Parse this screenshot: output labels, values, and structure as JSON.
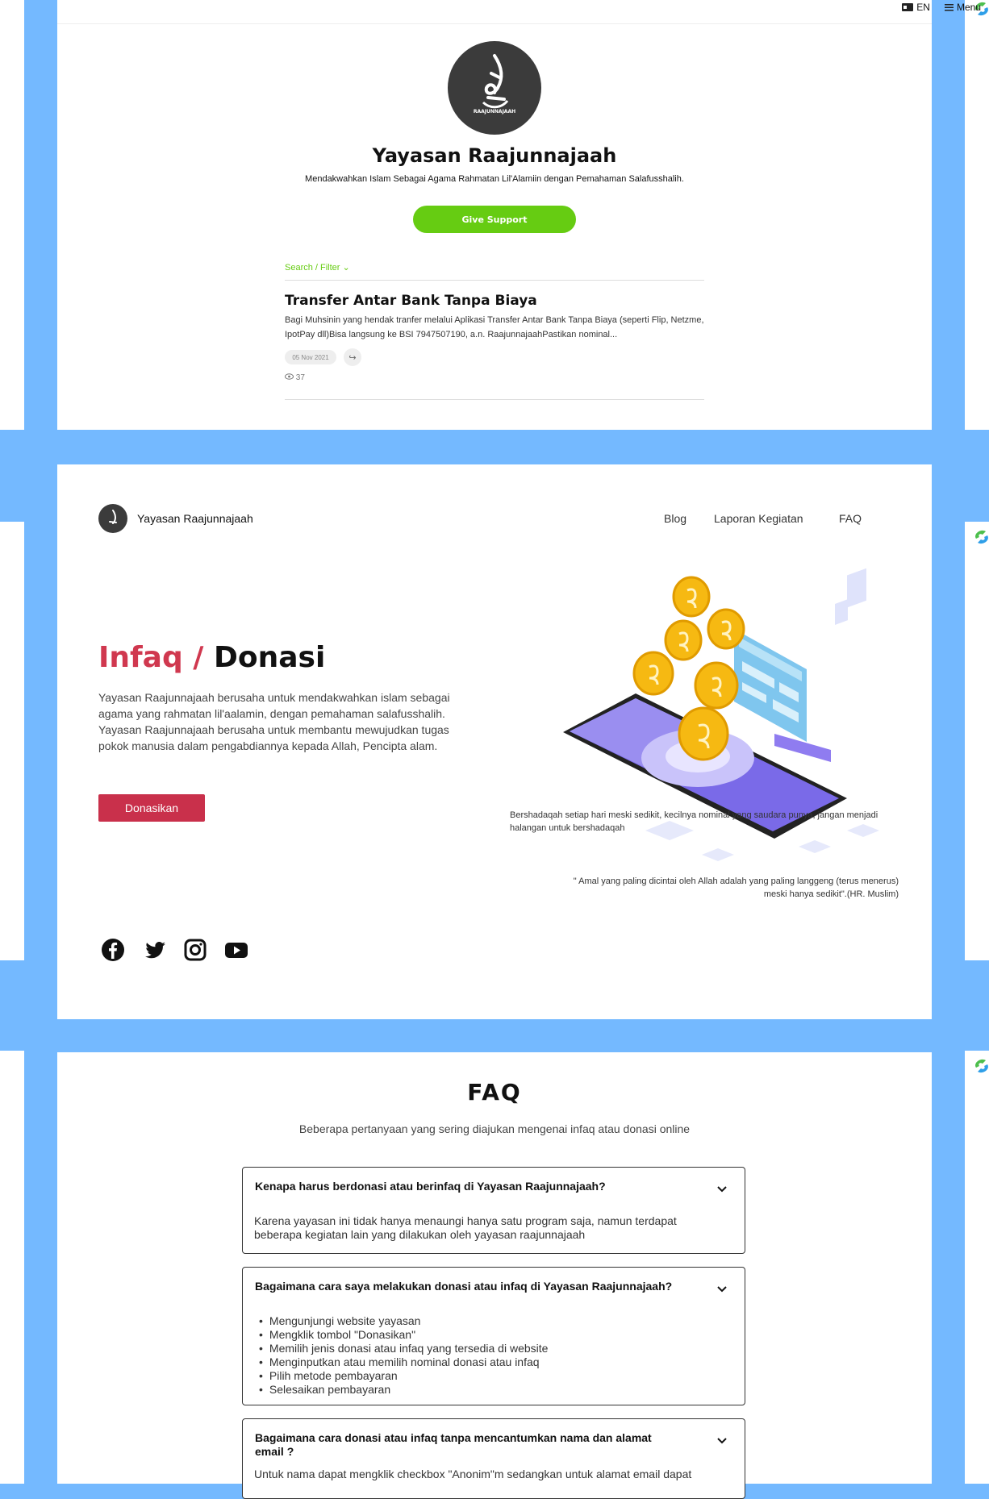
{
  "top": {
    "lang": "EN",
    "menu": "Menu",
    "org_name": "Yayasan Raajunnajaah",
    "tagline": "Mendakwahkan Islam Sebagai Agama Rahmatan Lil'Alamiin dengan Pemahaman Salafusshalih.",
    "logo_text": "RAAJUNNAJAAH",
    "give_support": "Give Support",
    "filter": "Search / Filter",
    "post": {
      "title": "Transfer Antar Bank Tanpa Biaya",
      "body": "Bagi Muhsinin yang hendak tranfer melalui Aplikasi Transfer Antar Bank Tanpa Biaya (seperti Flip, Netzme, IpotPay dll)Bisa langsung ke BSI 7947507190, a.n. RaajunnajaahPastikan nominal...",
      "date": "05 Nov 2021",
      "views": "37"
    }
  },
  "site": {
    "brand": "Yayasan Raajunnajaah",
    "nav": [
      "Blog",
      "Laporan Kegiatan",
      "FAQ"
    ],
    "hero_title_a": "Infaq",
    "hero_title_sep": "/",
    "hero_title_b": "Donasi",
    "hero_desc": "Yayasan Raajunnajaah berusaha untuk mendakwahkan islam sebagai agama yang rahmatan lil'aalamin, dengan pemahaman salafusshalih. Yayasan Raajunnajaah berusaha untuk membantu mewujudkan tugas pokok manusia dalam pengabdiannya kepada Allah, Pencipta alam.",
    "donate_btn": "Donasikan",
    "caption": "Bershadaqah setiap hari meski sedikit, kecilnya nominal yang saudara punya, jangan menjadi halangan untuk bershadaqah",
    "quote": "\" Amal yang paling dicintai oleh Allah adalah yang paling langgeng (terus menerus) meski hanya sedikit\".(HR. Muslim)",
    "social": [
      "facebook-icon",
      "twitter-icon",
      "instagram-icon",
      "youtube-icon"
    ]
  },
  "faq": {
    "title": "FAQ",
    "subtitle": "Beberapa pertanyaan yang sering diajukan mengenai infaq atau donasi online",
    "items": [
      {
        "q": "Kenapa harus berdonasi atau berinfaq di Yayasan Raajunnajaah?",
        "a": "Karena yayasan ini tidak hanya menaungi hanya satu program saja, namun terdapat beberapa kegiatan lain yang dilakukan oleh yayasan raajunnajaah"
      },
      {
        "q": "Bagaimana cara saya melakukan donasi atau infaq di Yayasan Raajunnajaah?",
        "steps": [
          "Mengunjungi website yayasan",
          "Mengklik tombol \"Donasikan\"",
          "Memilih jenis donasi atau infaq yang tersedia di website",
          "Menginputkan atau memilih nominal donasi atau infaq",
          "Pilih metode pembayaran",
          "Selesaikan pembayaran"
        ]
      },
      {
        "q": "Bagaimana cara donasi atau infaq tanpa mencantumkan nama dan alamat email ?",
        "a": "Untuk nama dapat mengklik checkbox \"Anonim\"m sedangkan untuk alamat email dapat"
      }
    ]
  },
  "colors": {
    "background": "#74b9ff",
    "green": "#66cc12",
    "red": "#c9304b",
    "accent_title": "#d0384f"
  }
}
